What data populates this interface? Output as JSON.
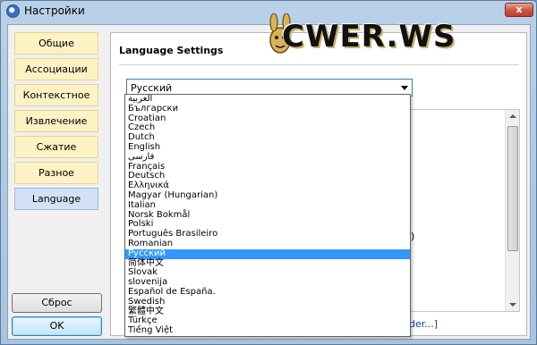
{
  "window": {
    "title": "Настройки",
    "close_glyph": "x"
  },
  "nav": {
    "items": [
      {
        "label": "Общие"
      },
      {
        "label": "Ассоциации"
      },
      {
        "label": "Контекстное меню"
      },
      {
        "label": "Извлечение"
      },
      {
        "label": "Сжатие"
      },
      {
        "label": "Разное"
      },
      {
        "label": "Language",
        "active": true
      }
    ]
  },
  "buttons": {
    "reset_label": "Сброс",
    "ok_label": "OK"
  },
  "panel": {
    "heading": "Language Settings",
    "partial_text": ")",
    "partial_link": "der...]"
  },
  "language_select": {
    "selected": "Русский",
    "options": [
      "العربية",
      "Български",
      "Croatian",
      "Czech",
      "Dutch",
      "English",
      "فارسی",
      "Français",
      "Deutsch",
      "Ελληνικά",
      "Magyar (Hungarian)",
      "Italian",
      "Norsk Bokmål",
      "Polski",
      "Português Brasileiro",
      "Romanian",
      "Русский",
      "简体中文",
      "Slovak",
      "slovenija",
      "Español de España.",
      "Swedish",
      "繁體中文",
      "Türkçe",
      "Tiếng Việt"
    ]
  },
  "watermark": {
    "text": "CWER.WS"
  },
  "colors": {
    "nav_bg": "#fdf2c4",
    "nav_active_bg": "#d4e1f4",
    "selection": "#3399ff",
    "close_button": "#c9553d"
  }
}
